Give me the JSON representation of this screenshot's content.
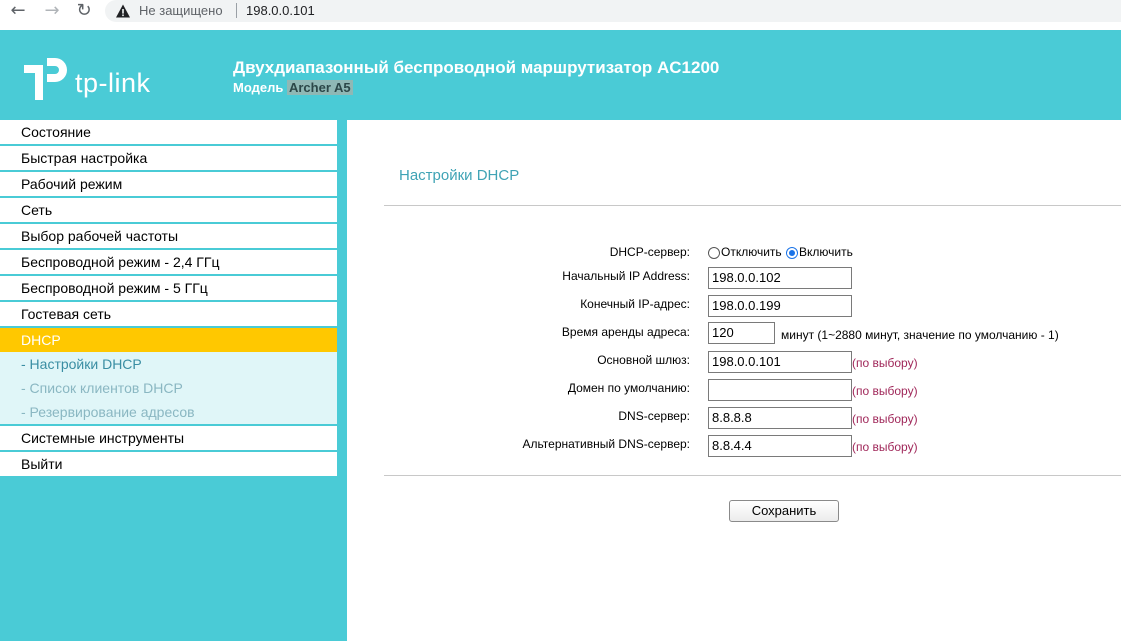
{
  "browser": {
    "security_text": "Не защищено",
    "url": "198.0.0.101"
  },
  "header": {
    "logo_text": "tp-link",
    "product_title": "Двухдиапазонный беспроводной маршрутизатор AC1200",
    "model_label": "Модель",
    "model_value": "Archer A5"
  },
  "sidebar": {
    "items": [
      {
        "label": "Состояние"
      },
      {
        "label": "Быстрая настройка"
      },
      {
        "label": "Рабочий режим"
      },
      {
        "label": "Сеть"
      },
      {
        "label": "Выбор рабочей частоты"
      },
      {
        "label": "Беспроводной режим - 2,4 ГГц"
      },
      {
        "label": "Беспроводной режим - 5 ГГц"
      },
      {
        "label": "Гостевая сеть"
      },
      {
        "label": "DHCP",
        "active": true
      },
      {
        "label": "Системные инструменты"
      },
      {
        "label": "Выйти"
      }
    ],
    "subitems": [
      {
        "label": "- Настройки DHCP",
        "current": true
      },
      {
        "label": "- Список клиентов DHCP"
      },
      {
        "label": "- Резервирование адресов"
      }
    ]
  },
  "main": {
    "title": "Настройки DHCP",
    "dhcp_server": {
      "label": "DHCP-сервер:",
      "option_off": "Отключить",
      "option_on": "Включить",
      "selected": "on"
    },
    "fields": {
      "start_ip": {
        "label": "Начальный IP Address:",
        "value": "198.0.0.102"
      },
      "end_ip": {
        "label": "Конечный IP-адрес:",
        "value": "198.0.0.199"
      },
      "lease_time": {
        "label": "Время аренды адреса:",
        "value": "120",
        "hint": "минут (1~2880 минут, значение по умолчанию - 1)"
      },
      "gateway": {
        "label": "Основной шлюз:",
        "value": "198.0.0.101",
        "optional": "(по выбору)"
      },
      "domain": {
        "label": "Домен по умолчанию:",
        "value": "",
        "optional": "(по выбору)"
      },
      "dns": {
        "label": "DNS-сервер:",
        "value": "8.8.8.8",
        "optional": "(по выбору)"
      },
      "dns_alt": {
        "label": "Альтернативный DNS-сервер:",
        "value": "8.8.4.4",
        "optional": "(по выбору)"
      }
    },
    "save_label": "Сохранить"
  },
  "colors": {
    "brand": "#4acbd6",
    "active_menu": "#ffc800",
    "title": "#3fa3b5",
    "optional": "#a0285a"
  },
  "icons": [
    "back-arrow-icon",
    "forward-arrow-icon",
    "reload-icon",
    "warning-icon",
    "tp-link-logo-icon"
  ]
}
